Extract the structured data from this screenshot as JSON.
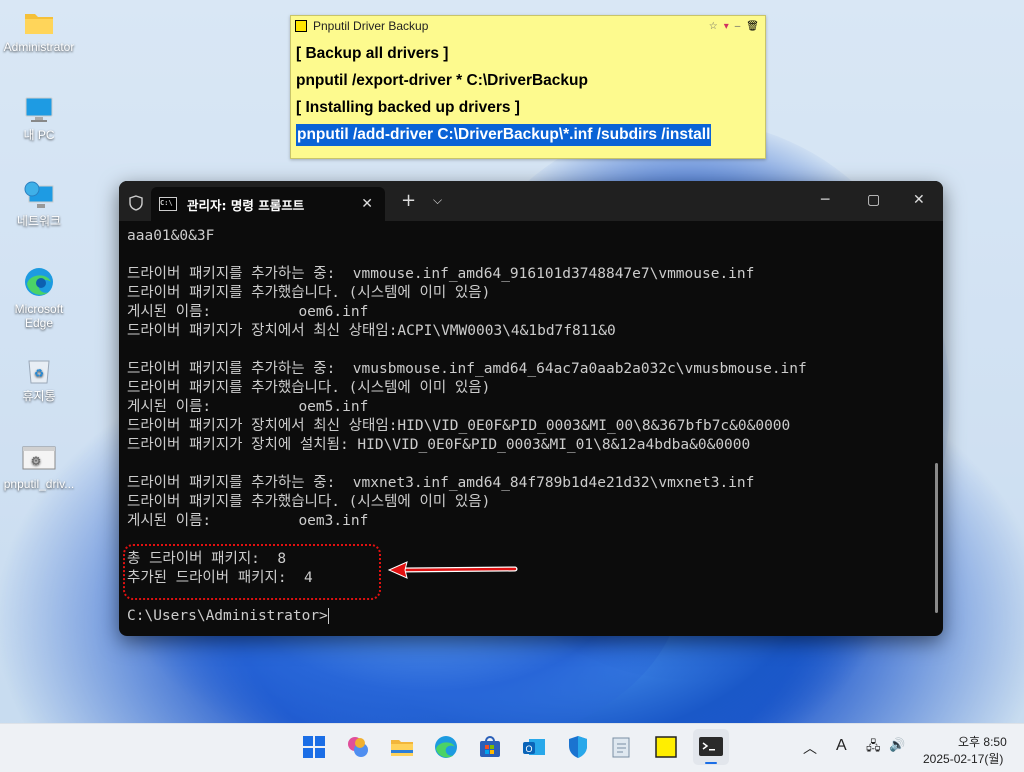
{
  "desktop": {
    "icons": [
      {
        "label": "Administrator",
        "icon": "folder-icon"
      },
      {
        "label": "내 PC",
        "icon": "computer-icon"
      },
      {
        "label": "네트워크",
        "icon": "network-icon"
      },
      {
        "label": "Microsoft Edge",
        "icon": "edge-icon"
      },
      {
        "label": "휴지통",
        "icon": "recycle-bin-icon"
      },
      {
        "label": "pnputil_driv...",
        "icon": "batch-file-icon"
      }
    ]
  },
  "sticky_note": {
    "title": "Pnputil Driver Backup",
    "lines": [
      "[ Backup all drivers ]",
      "pnputil /export-driver * C:\\DriverBackup",
      "[ Installing backed up drivers ]",
      "pnputil /add-driver C:\\DriverBackup\\*.inf /subdirs /install"
    ]
  },
  "terminal": {
    "tab_title": "관리자: 명령 프롬프트",
    "console_lines": [
      "aaa01&0&3F",
      "",
      "드라이버 패키지를 추가하는 중:  vmmouse.inf_amd64_916101d3748847e7\\vmmouse.inf",
      "드라이버 패키지를 추가했습니다. (시스템에 이미 있음)",
      "게시된 이름:          oem6.inf",
      "드라이버 패키지가 장치에서 최신 상태임:ACPI\\VMW0003\\4&1bd7f811&0",
      "",
      "드라이버 패키지를 추가하는 중:  vmusbmouse.inf_amd64_64ac7a0aab2a032c\\vmusbmouse.inf",
      "드라이버 패키지를 추가했습니다. (시스템에 이미 있음)",
      "게시된 이름:          oem5.inf",
      "드라이버 패키지가 장치에서 최신 상태임:HID\\VID_0E0F&PID_0003&MI_00\\8&367bfb7c&0&0000",
      "드라이버 패키지가 장치에 설치됨: HID\\VID_0E0F&PID_0003&MI_01\\8&12a4bdba&0&0000",
      "",
      "드라이버 패키지를 추가하는 중:  vmxnet3.inf_amd64_84f789b1d4e21d32\\vmxnet3.inf",
      "드라이버 패키지를 추가했습니다. (시스템에 이미 있음)",
      "게시된 이름:          oem3.inf",
      "",
      "총 드라이버 패키지:  8",
      "추가된 드라이버 패키지:  4",
      "",
      "C:\\Users\\Administrator>"
    ]
  },
  "taskbar": {
    "apps": [
      "start-icon",
      "copilot-icon",
      "file-explorer-icon",
      "edge-icon",
      "store-icon",
      "outlook-icon",
      "defender-icon",
      "notepad-icon",
      "sticky-notes-icon",
      "terminal-icon"
    ],
    "tray": {
      "ime": "A",
      "time": "오후 8:50",
      "date": "2025-02-17(월)"
    }
  },
  "colors": {
    "note_bg": "#fdfa8e",
    "selection": "#0a63d6",
    "highlight_box": "#e01010"
  }
}
